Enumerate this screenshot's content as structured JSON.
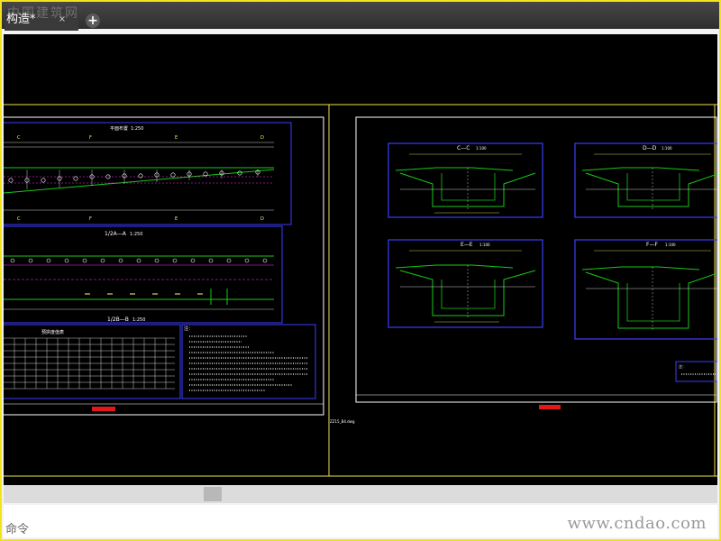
{
  "window": {
    "tab_title": "构造*",
    "tab_close_icon": "×",
    "tab_add_icon": "+",
    "watermark_top": "中国建筑网"
  },
  "drawing": {
    "left_sheet": {
      "plan_title": "平面布置",
      "plan_scale": "1:250",
      "plan_axis_labels": [
        "C",
        "F",
        "E",
        "D"
      ],
      "plan_lower_axis_labels": [
        "C",
        "F",
        "E",
        "D"
      ],
      "section_a_title": "1/2A—A",
      "section_a_scale": "1:250",
      "section_b_title": "1/2B—B",
      "section_b_scale": "1:250",
      "table_title": "预拱度值表",
      "notes_title": "注："
    },
    "right_sheet": {
      "sections": [
        {
          "title": "C—C",
          "scale": "1:100"
        },
        {
          "title": "D—D",
          "scale": "1:100"
        },
        {
          "title": "E—E",
          "scale": "1:100"
        },
        {
          "title": "F—F",
          "scale": "1:100"
        }
      ],
      "notes_title": "注：",
      "file_label": "ZZ15_B4.dwg"
    },
    "colors": {
      "sheet_border": "#ffffff",
      "frame": "#3d3dff",
      "girder": "#18c818",
      "rebar": "#ff33ff",
      "dim": "#ffff66",
      "title_bar": "#e01818",
      "yellow_line": "#f0e04a"
    }
  },
  "command_line": {
    "label": "命令",
    "site_watermark": "www.cndao.com"
  }
}
